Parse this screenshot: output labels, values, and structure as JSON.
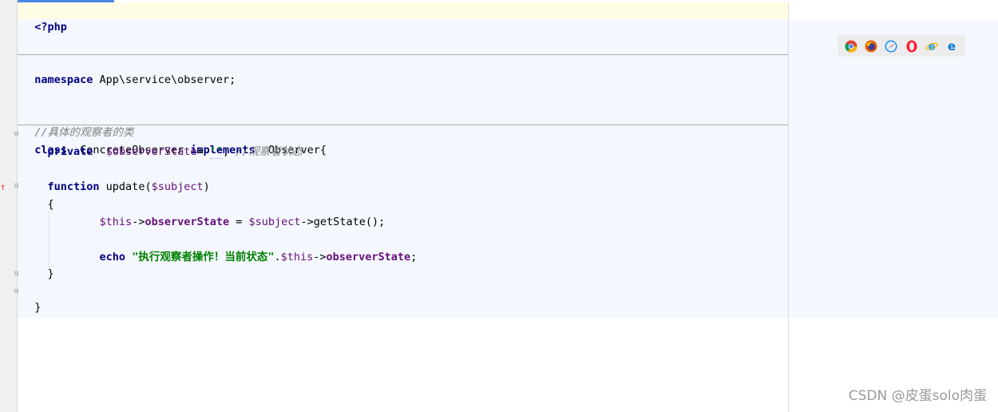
{
  "code": {
    "line_php_open": "<?php",
    "kw_namespace": "namespace",
    "namespace_path": " App\\service\\observer;",
    "comment_class": "//具体的观察者的类",
    "kw_class": "class",
    "class_name": "  ConcreteObserver ",
    "kw_implements": "implements",
    "iface": "  Observer{",
    "kw_private": "private",
    "prop_state": "$observerState",
    "assign_empty": "= ",
    "empty_str": "''",
    "semi": "; ",
    "comment_state": "//观察者状态",
    "kw_function": "function",
    "fn_sig_a": " update(",
    "param_subject": "$subject",
    "fn_sig_b": ")",
    "brace_open": "{",
    "this_var": "$this",
    "arrow": "->",
    "prop_name": "observerState",
    "assign_eq": " = ",
    "subject_var": "$subject",
    "get_state": "->getState();",
    "kw_echo": "echo",
    "echo_str": "\"执行观察者操作！当前状态\"",
    "concat": ".",
    "this_var2": "$this",
    "arrow2": "->",
    "prop_name2": "observerState",
    "semi2": ";",
    "brace_close_inner": "}",
    "brace_close_outer": "}"
  },
  "browsers": [
    "chrome-icon",
    "firefox-icon",
    "safari-icon",
    "opera-icon",
    "ie-icon",
    "edge-icon"
  ],
  "watermark": "CSDN @皮蛋solo肉蛋",
  "colors": {
    "keyword": "#000080",
    "variable": "#660e7a",
    "string": "#008000",
    "comment": "#808080",
    "line_highlight": "#fefce4",
    "editor_tint": "#f4f8fe"
  }
}
